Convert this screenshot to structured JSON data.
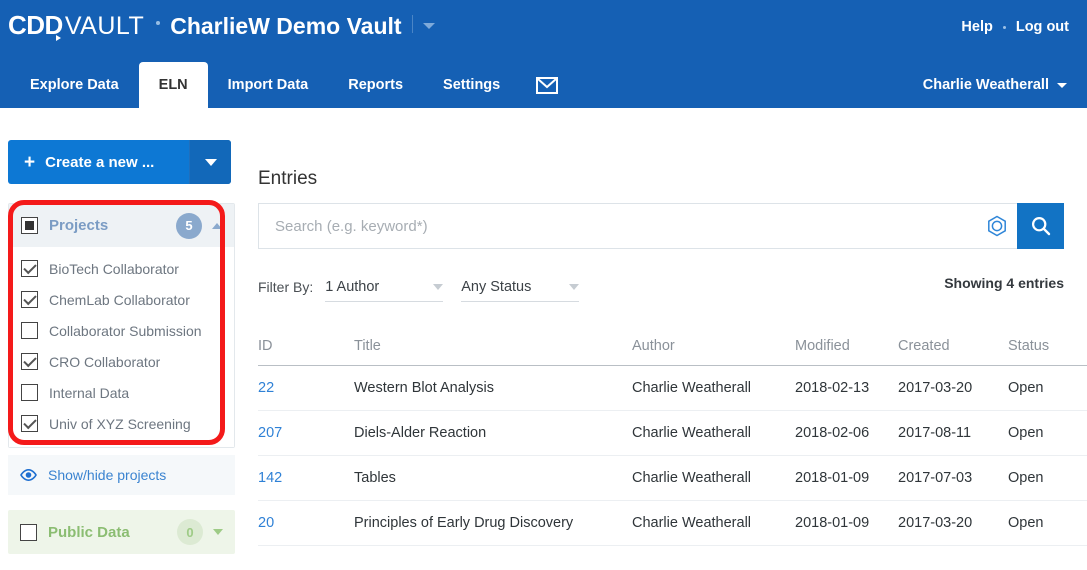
{
  "header": {
    "logo_cdd": "CDD",
    "logo_vault": "VAULT",
    "vault_name": "CharlieW Demo Vault",
    "help_label": "Help",
    "logout_label": "Log out",
    "user_name": "Charlie Weatherall"
  },
  "nav": {
    "tabs": [
      {
        "label": "Explore Data",
        "active": false
      },
      {
        "label": "ELN",
        "active": true
      },
      {
        "label": "Import Data",
        "active": false
      },
      {
        "label": "Reports",
        "active": false
      },
      {
        "label": "Settings",
        "active": false
      }
    ],
    "mail_icon": "envelope-icon"
  },
  "sidebar": {
    "create_button": {
      "label": "Create a new ...",
      "plus": "+"
    },
    "projects": {
      "title": "Projects",
      "count": "5",
      "checkbox_state": "partial",
      "items": [
        {
          "label": "BioTech Collaborator",
          "checked": true
        },
        {
          "label": "ChemLab Collaborator",
          "checked": true
        },
        {
          "label": "Collaborator Submission",
          "checked": false
        },
        {
          "label": "CRO Collaborator",
          "checked": true
        },
        {
          "label": "Internal Data",
          "checked": false
        },
        {
          "label": "Univ of XYZ Screening",
          "checked": true
        }
      ]
    },
    "show_hide_label": "Show/hide projects",
    "public_data": {
      "title": "Public Data",
      "count": "0",
      "checked": false
    }
  },
  "main": {
    "page_title": "Entries",
    "search": {
      "placeholder": "Search (e.g. keyword*)",
      "value": "",
      "structure_icon": "benzene-ring-icon",
      "search_icon": "magnifier-icon"
    },
    "filter": {
      "label": "Filter By:",
      "author_value": "1 Author",
      "status_value": "Any Status",
      "showing": "Showing 4 entries"
    },
    "table": {
      "columns": [
        "ID",
        "Title",
        "Author",
        "Modified",
        "Created",
        "Status"
      ],
      "rows": [
        {
          "id": "22",
          "title": "Western Blot Analysis",
          "author": "Charlie Weatherall",
          "modified": "2018-02-13",
          "created": "2017-03-20",
          "status": "Open"
        },
        {
          "id": "207",
          "title": "Diels-Alder Reaction",
          "author": "Charlie Weatherall",
          "modified": "2018-02-06",
          "created": "2017-08-11",
          "status": "Open"
        },
        {
          "id": "142",
          "title": "Tables",
          "author": "Charlie Weatherall",
          "modified": "2018-01-09",
          "created": "2017-07-03",
          "status": "Open"
        },
        {
          "id": "20",
          "title": "Principles of Early Drug Discovery",
          "author": "Charlie Weatherall",
          "modified": "2018-01-09",
          "created": "2017-03-20",
          "status": "Open"
        }
      ]
    }
  },
  "annotation": {
    "highlight_color": "#f41a1a"
  },
  "colors": {
    "header_blue": "#1560b4",
    "button_blue": "#0d78d4",
    "link_blue": "#2f81d6",
    "green": "#8bbd72"
  }
}
